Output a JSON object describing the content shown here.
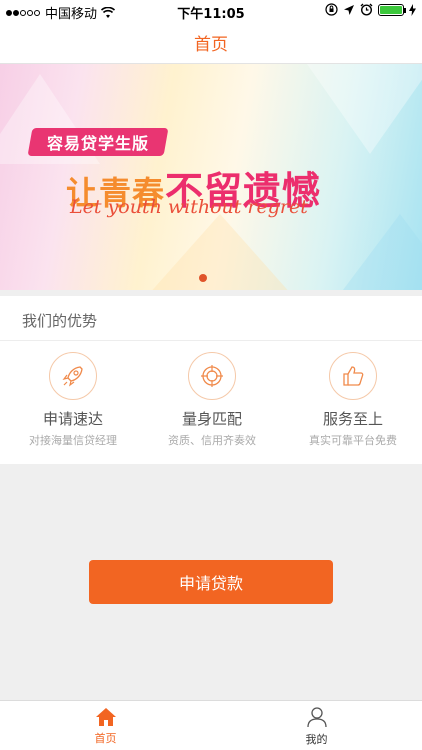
{
  "status_bar": {
    "carrier": "中国移动",
    "time": "下午11:05"
  },
  "nav": {
    "title": "首页"
  },
  "banner": {
    "badge": "容易贷学生版",
    "title_part1": "让青春",
    "title_part2": "不留遗憾",
    "subtitle": "Let youth without regret",
    "page_indicator": {
      "current": 1,
      "total": 1
    }
  },
  "advantages": {
    "title": "我们的优势",
    "items": [
      {
        "icon": "rocket-icon",
        "name": "申请速达",
        "desc": "对接海量信贷经理"
      },
      {
        "icon": "target-icon",
        "name": "量身匹配",
        "desc": "资质、信用齐奏效"
      },
      {
        "icon": "thumbs-up-icon",
        "name": "服务至上",
        "desc": "真实可靠平台免费"
      }
    ]
  },
  "apply_button": {
    "label": "申请贷款"
  },
  "tabbar": {
    "items": [
      {
        "label": "首页",
        "icon": "home-icon",
        "active": true
      },
      {
        "label": "我的",
        "icon": "user-icon",
        "active": false
      }
    ]
  },
  "colors": {
    "accent": "#f26522",
    "battery": "#3cc83c"
  }
}
